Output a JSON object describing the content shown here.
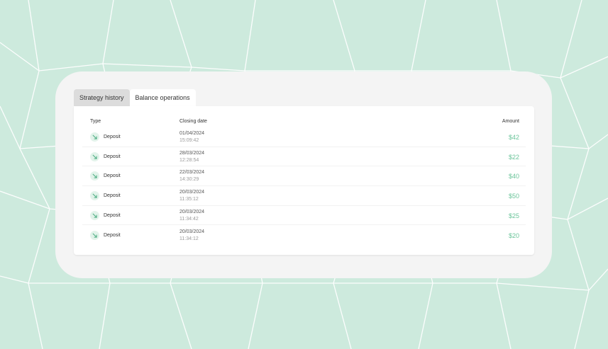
{
  "tabs": [
    {
      "label": "Strategy history",
      "active": false
    },
    {
      "label": "Balance operations",
      "active": true
    }
  ],
  "table": {
    "headers": {
      "type": "Type",
      "closing_date": "Closing date",
      "amount": "Amount"
    },
    "rows": [
      {
        "type": "Deposit",
        "date": "01/04/2024",
        "time": "15:09:42",
        "amount": "$42"
      },
      {
        "type": "Deposit",
        "date": "28/03/2024",
        "time": "12:28:54",
        "amount": "$22"
      },
      {
        "type": "Deposit",
        "date": "22/03/2024",
        "time": "14:30:29",
        "amount": "$40"
      },
      {
        "type": "Deposit",
        "date": "20/03/2024",
        "time": "11:35:12",
        "amount": "$50"
      },
      {
        "type": "Deposit",
        "date": "20/03/2024",
        "time": "11:34:42",
        "amount": "$25"
      },
      {
        "type": "Deposit",
        "date": "20/03/2024",
        "time": "11:34:12",
        "amount": "$20"
      }
    ]
  },
  "colors": {
    "background": "#cdeadd",
    "card": "#f4f4f4",
    "amount_green": "#6cc59b",
    "icon_green": "#4fae84"
  },
  "icons": {
    "deposit": "arrow-down-right-icon"
  }
}
